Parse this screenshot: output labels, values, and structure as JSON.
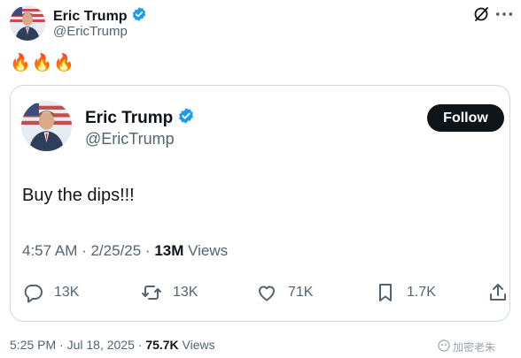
{
  "outer": {
    "name": "Eric Trump",
    "handle": "@EricTrump",
    "text": "🔥🔥🔥"
  },
  "quoted": {
    "name": "Eric Trump",
    "handle": "@EricTrump",
    "follow_label": "Follow",
    "text": "Buy the dips!!!",
    "time": "4:57 AM · 2/25/25 · ",
    "views_count": "13M",
    "views_label": " Views",
    "stats": {
      "replies": "13K",
      "reposts": "13K",
      "likes": "71K",
      "bookmarks": "1.7K"
    }
  },
  "footer": {
    "time": "5:25 PM · Jul 18, 2025 · ",
    "views_count": "75.7K",
    "views_label": " Views"
  },
  "watermark": "加密老朱",
  "icons": {
    "verified": "verified-badge-icon",
    "grok": "grok-icon",
    "more": "more-icon",
    "reply": "reply-icon",
    "repost": "repost-icon",
    "like": "heart-icon",
    "bookmark": "bookmark-icon",
    "share": "share-icon"
  },
  "colors": {
    "verified": "#1d9bf0",
    "text": "#0f1419",
    "secondary": "#536471",
    "border": "#cfd9de",
    "follow_bg": "#0f1419"
  }
}
